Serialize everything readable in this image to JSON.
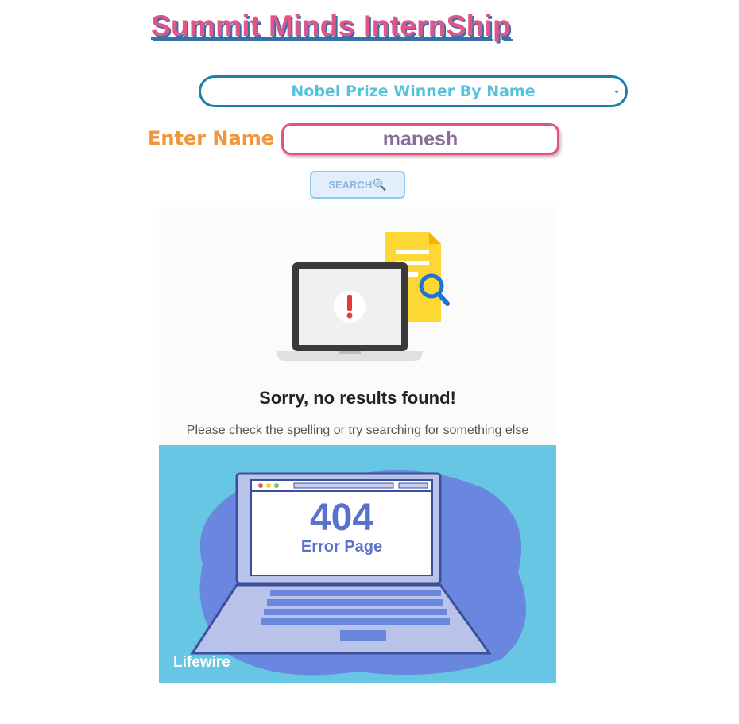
{
  "header": {
    "title": "Summit Minds InternShip"
  },
  "search_mode": {
    "selected": "Nobel Prize Winner By Name"
  },
  "form": {
    "name_label": "Enter Name :",
    "name_value": "manesh",
    "search_label": "SEARCH",
    "search_icon": "magnifier-icon"
  },
  "results": {
    "no_results_image": {
      "heading": "Sorry, no results found!",
      "subtext": "Please check the spelling or try searching for something else"
    },
    "error_image": {
      "code": "404",
      "label": "Error Page",
      "brand": "Lifewire"
    }
  },
  "colors": {
    "title": "#e0558a",
    "title_shadow": "#3a6fa8",
    "select_border": "#1d7fa8",
    "select_text": "#55c2dc",
    "label": "#f0953a",
    "input_border": "#e0557f",
    "input_text": "#8a6c9a",
    "button_bg": "#e2effa",
    "error_bg": "#66c6e4"
  }
}
